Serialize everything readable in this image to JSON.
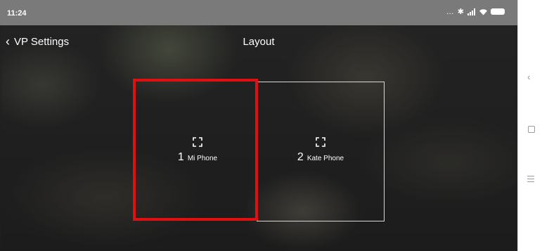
{
  "status_bar": {
    "time": "11:24",
    "icons": [
      "more-dots-icon",
      "bluetooth-icon",
      "signal-icon",
      "wifi-icon",
      "battery-icon"
    ]
  },
  "header": {
    "back_label": "VP Settings",
    "title": "Layout"
  },
  "tiles": [
    {
      "number": "1",
      "label": "Mi Phone",
      "icon": "fullscreen-icon",
      "selected": true
    },
    {
      "number": "2",
      "label": "Kate Phone",
      "icon": "fullscreen-icon",
      "selected": false
    }
  ],
  "colors": {
    "selection": "#e01010",
    "tile_border": "#d8d8d8",
    "status_bar": "#7a7a7a"
  },
  "nav_bar": {
    "buttons": [
      "back-icon",
      "home-icon",
      "menu-icon"
    ]
  }
}
